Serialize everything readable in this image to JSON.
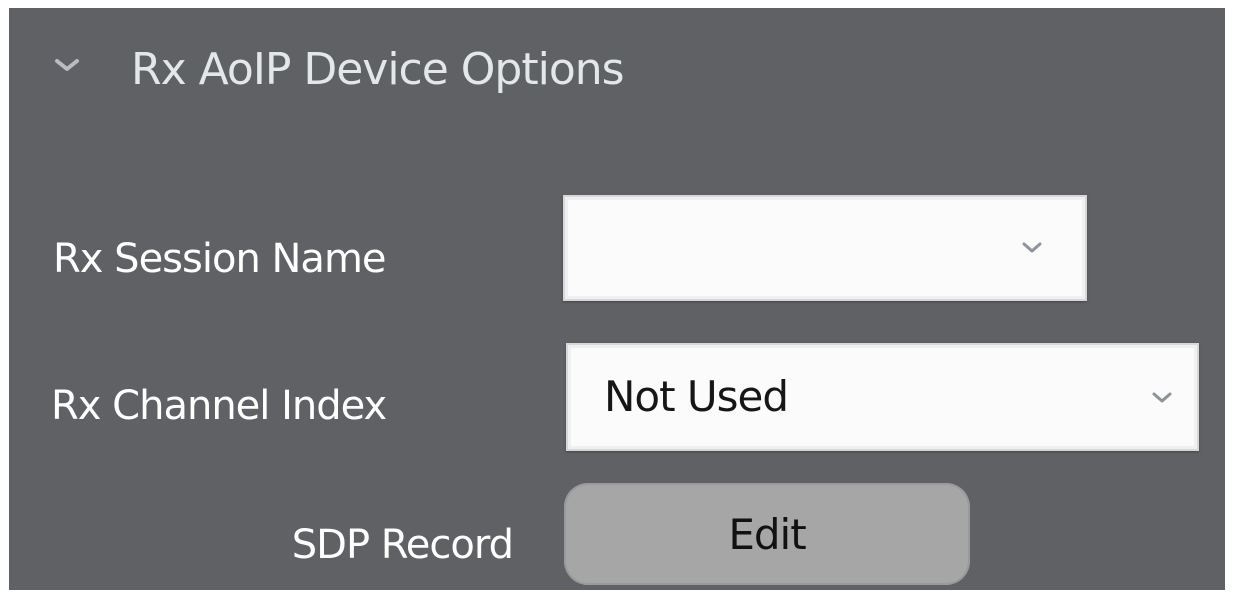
{
  "section": {
    "title": "Rx AoIP Device Options",
    "expanded_icon": "chevron-down-icon"
  },
  "fields": {
    "rx_session_name": {
      "label": "Rx Session Name",
      "value": "",
      "icon": "chevron-down-icon"
    },
    "rx_channel_index": {
      "label": "Rx Channel Index",
      "value": "Not Used",
      "icon": "chevron-down-icon"
    },
    "sdp_record": {
      "label": "SDP Record",
      "button_label": "Edit"
    }
  },
  "colors": {
    "panel_background": "#5f6165",
    "label_text": "#ffffff",
    "select_background": "#fbfbfb",
    "button_background": "#a6a6a6"
  }
}
